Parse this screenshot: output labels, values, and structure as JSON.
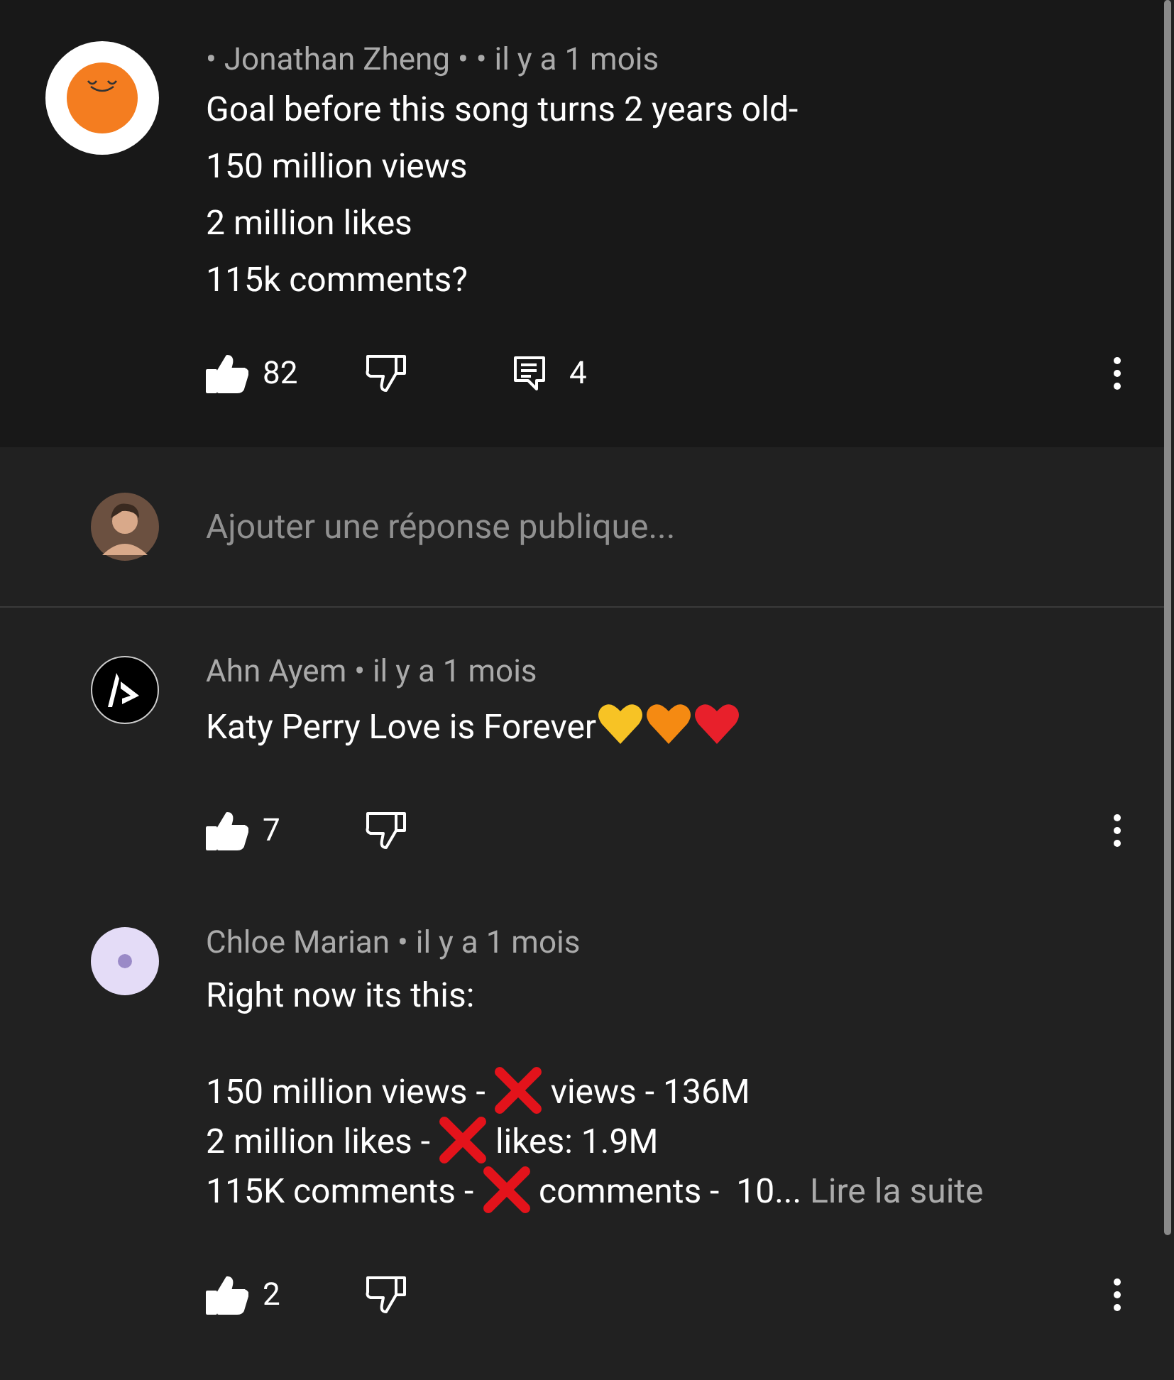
{
  "highlighted_comment": {
    "avatar": {
      "kind": "orange"
    },
    "meta": "• Jonathan Zheng • • il y a 1 mois",
    "lines": [
      "Goal before this song turns 2 years old-",
      "150 million views",
      "2 million likes",
      "115k comments?"
    ],
    "liked": true,
    "likes": "82",
    "replies": "4"
  },
  "reply_box": {
    "placeholder": "Ajouter une réponse publique..."
  },
  "comments": [
    {
      "avatar": {
        "kind": "logo"
      },
      "meta": "Ahn Ayem • il y a 1 mois",
      "paragraphs": [
        [
          [
            {
              "kind": "text",
              "text": "Katy Perry Love is Forever"
            },
            {
              "kind": "heart",
              "color": "#f7c325"
            },
            {
              "kind": "heart",
              "color": "#f58a12"
            },
            {
              "kind": "heart",
              "color": "#e8202b"
            }
          ]
        ]
      ],
      "liked": true,
      "likes": "7"
    },
    {
      "avatar": {
        "kind": "lavender"
      },
      "meta": "Chloe Marian • il y a 1 mois",
      "paragraphs": [
        [
          [
            {
              "kind": "text",
              "text": "Right now its this:"
            }
          ]
        ],
        [
          [
            {
              "kind": "text",
              "text": "150 million views - "
            },
            {
              "kind": "cross"
            },
            {
              "kind": "text",
              "text": " views - 136M"
            }
          ],
          [
            {
              "kind": "text",
              "text": "2 million likes - "
            },
            {
              "kind": "cross"
            },
            {
              "kind": "text",
              "text": " likes: 1.9M"
            }
          ],
          [
            {
              "kind": "text",
              "text": "115K comments - "
            },
            {
              "kind": "cross"
            },
            {
              "kind": "text",
              "text": " comments -  10..."
            },
            {
              "kind": "more",
              "text": " Lire la suite"
            }
          ]
        ]
      ],
      "liked": true,
      "likes": "2"
    }
  ]
}
